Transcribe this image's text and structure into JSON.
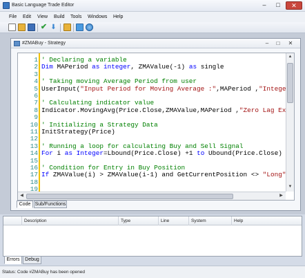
{
  "window": {
    "title": "Basic Language Trade Editor",
    "min": "–",
    "max": "□",
    "close": "✕"
  },
  "menu": [
    "File",
    "Edit",
    "View",
    "Build",
    "Tools",
    "Windows",
    "Help"
  ],
  "toolbar": {
    "icons": [
      {
        "name": "new-file-icon",
        "color": "#ffffff"
      },
      {
        "name": "open-folder-icon",
        "color": "#e8b23a"
      },
      {
        "name": "save-icon",
        "color": "#3f6fb8"
      },
      {
        "name": "check-icon",
        "color": "#2f9e3b"
      },
      {
        "name": "download-icon",
        "color": "#3a86d1"
      },
      {
        "name": "folder-up-icon",
        "color": "#e8b23a"
      },
      {
        "name": "image-icon",
        "color": "#4b9be0"
      },
      {
        "name": "network-icon",
        "color": "#2f7ac6"
      }
    ]
  },
  "doc": {
    "title": "#ZMABuy - Strategy",
    "lines": [
      {
        "n": "1",
        "parts": [
          [
            "cmt",
            "' Declaring a variable"
          ]
        ]
      },
      {
        "n": "2",
        "parts": [
          [
            "kw",
            "Dim "
          ],
          [
            "",
            "MAPeriod "
          ],
          [
            "kw",
            "as integer"
          ],
          [
            "",
            ", ZMAValue(-1) "
          ],
          [
            "kw",
            "as"
          ],
          [
            "",
            " single"
          ]
        ]
      },
      {
        "n": "3",
        "parts": []
      },
      {
        "n": "4",
        "parts": [
          [
            "cmt",
            "' Taking moving Average Period from user"
          ]
        ]
      },
      {
        "n": "5",
        "parts": [
          [
            "",
            "UserInput("
          ],
          [
            "str",
            "\"Input Period for Moving Average :\""
          ],
          [
            "",
            ",MAPeriod ,"
          ],
          [
            "str",
            "\"Integer\""
          ]
        ]
      },
      {
        "n": "6",
        "parts": []
      },
      {
        "n": "7",
        "parts": [
          [
            "cmt",
            "' Calculating indicator value"
          ]
        ]
      },
      {
        "n": "8",
        "parts": [
          [
            "",
            "Indicator.MovingAvg(Price.Close,ZMAValue,MAPeriod ,"
          ],
          [
            "str",
            "\"Zero Lag Expo"
          ]
        ]
      },
      {
        "n": "9",
        "parts": []
      },
      {
        "n": "10",
        "parts": [
          [
            "cmt",
            "' Initializing a Strategy Data"
          ]
        ]
      },
      {
        "n": "11",
        "parts": [
          [
            "",
            "InitStrategy(Price)"
          ]
        ]
      },
      {
        "n": "12",
        "parts": []
      },
      {
        "n": "13",
        "parts": [
          [
            "cmt",
            "' Running a loop for calculating Buy and Sell Signal"
          ]
        ]
      },
      {
        "n": "14",
        "parts": [
          [
            "kw",
            "For"
          ],
          [
            "",
            " i "
          ],
          [
            "kw",
            "as Integer"
          ],
          [
            "",
            "=Lbound(Price.Close) +1 "
          ],
          [
            "kw",
            "to"
          ],
          [
            "",
            " Ubound(Price.Close)"
          ]
        ]
      },
      {
        "n": "15",
        "parts": []
      },
      {
        "n": "16",
        "parts": [
          [
            "cmt",
            "' Condition for Entry in Buy Position"
          ]
        ]
      },
      {
        "n": "17",
        "parts": [
          [
            "kw",
            "If"
          ],
          [
            "",
            " ZMAValue(i) > ZMAValue(i-1) and GetCurrentPosition <> "
          ],
          [
            "str",
            "\"Long\""
          ],
          [
            "",
            " t"
          ]
        ]
      },
      {
        "n": "18",
        "parts": []
      },
      {
        "n": "19",
        "parts": []
      }
    ],
    "tabs": [
      "Code",
      "Sub/Functions"
    ]
  },
  "errors_panel": {
    "columns": [
      "Description",
      "Type",
      "Line",
      "System",
      "Help"
    ],
    "tabs": [
      "Errors",
      "Debug"
    ]
  },
  "status": "Status: Code #ZMABuy has been opened"
}
